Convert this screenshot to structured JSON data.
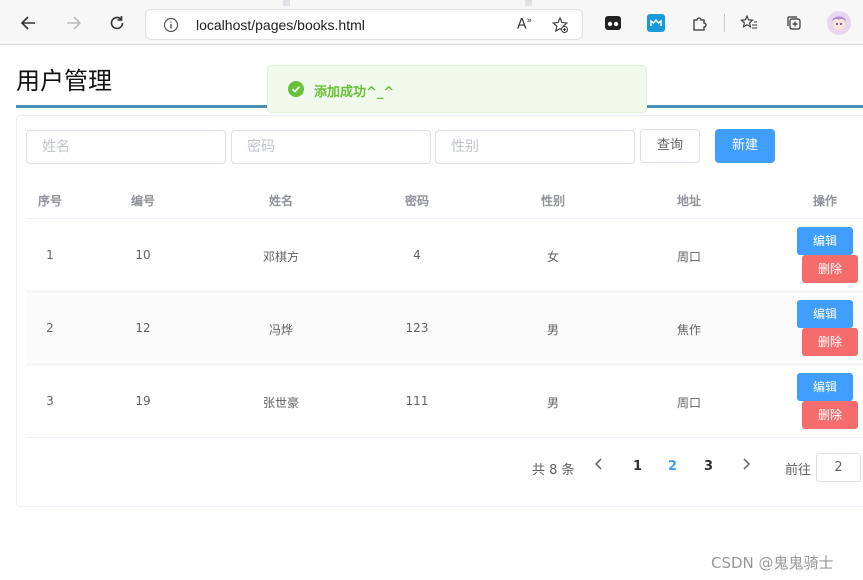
{
  "browser": {
    "url": "localhost/pages/books.html"
  },
  "page": {
    "title": "用户管理"
  },
  "toast": {
    "message": "添加成功^_^"
  },
  "search": {
    "name_placeholder": "姓名",
    "password_placeholder": "密码",
    "gender_placeholder": "性别",
    "query_label": "查询",
    "new_label": "新建"
  },
  "table": {
    "columns": [
      "序号",
      "编号",
      "姓名",
      "密码",
      "性别",
      "地址",
      "操作"
    ],
    "rows": [
      {
        "index": "1",
        "id": "10",
        "name": "邓棋方",
        "password": "4",
        "gender": "女",
        "address": "周口"
      },
      {
        "index": "2",
        "id": "12",
        "name": "冯烨",
        "password": "123",
        "gender": "男",
        "address": "焦作"
      },
      {
        "index": "3",
        "id": "19",
        "name": "张世豪",
        "password": "111",
        "gender": "男",
        "address": "周口"
      }
    ],
    "edit_label": "编辑",
    "delete_label": "删除"
  },
  "pagination": {
    "total": "共 8 条",
    "pages": [
      "1",
      "2",
      "3"
    ],
    "current": "2",
    "goto_label": "前往",
    "goto_value": "2"
  },
  "watermark": "CSDN @鬼鬼骑士",
  "colors": {
    "primary": "#409eff",
    "danger": "#f56c6c",
    "success": "#67c23a"
  }
}
